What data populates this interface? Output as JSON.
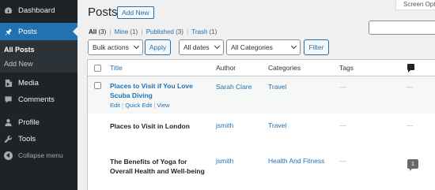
{
  "sidebar": {
    "dashboard": "Dashboard",
    "posts": "Posts",
    "submenu": {
      "all_posts": "All Posts",
      "add_new": "Add New"
    },
    "media": "Media",
    "comments": "Comments",
    "profile": "Profile",
    "tools": "Tools",
    "collapse": "Collapse menu"
  },
  "header": {
    "title": "Posts",
    "add_new": "Add New",
    "screen_options": "Screen Opt"
  },
  "filters": {
    "all": "All",
    "all_count": "(3)",
    "mine": "Mine",
    "mine_count": "(1)",
    "published": "Published",
    "published_count": "(3)",
    "trash": "Trash",
    "trash_count": "(1)",
    "separator": "|"
  },
  "bulk": {
    "actions_selected": "Bulk actions",
    "apply": "Apply",
    "dates_selected": "All dates",
    "categories_selected": "All Categories",
    "filter": "Filter"
  },
  "table": {
    "columns": {
      "title": "Title",
      "author": "Author",
      "categories": "Categories",
      "tags": "Tags"
    },
    "rows": [
      {
        "title_line1": "Places to Visit if You Love",
        "title_line2": "Scuba Diving",
        "author": "Sarah Clare",
        "category": "Travel",
        "tags": "—",
        "comments": "—",
        "actions": {
          "edit": "Edit",
          "quick_edit": "Quick Edit",
          "view": "View",
          "sep": "|"
        }
      },
      {
        "title_line1": "Places to Visit in London",
        "author": "jsmith",
        "category": "Travel",
        "tags": "—",
        "comments": "—"
      },
      {
        "title_line1": "The Benefits of Yoga for",
        "title_line2": "Overall Health and Well-being",
        "author": "jsmith",
        "category": "Health And Fitness",
        "tags": "—",
        "comments": "1"
      }
    ]
  },
  "colors": {
    "sidebar_bg": "#1d2327",
    "accent": "#2271b1",
    "page_bg": "#f0f0f1"
  }
}
